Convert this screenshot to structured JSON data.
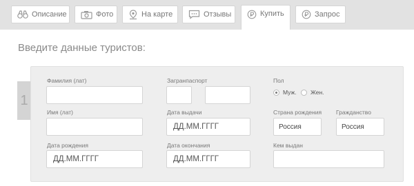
{
  "tabs": [
    {
      "label": "Описание",
      "icon": "binoculars-icon"
    },
    {
      "label": "Фото",
      "icon": "camera-icon"
    },
    {
      "label": "На карте",
      "icon": "map-pin-icon"
    },
    {
      "label": "Отзывы",
      "icon": "chat-icon"
    },
    {
      "label": "Купить",
      "icon": "ruble-coin-icon"
    },
    {
      "label": "Запрос",
      "icon": "ruble-coin-icon"
    }
  ],
  "active_tab": "Купить",
  "heading": "Введите данные туристов:",
  "tourist_number": "1",
  "fields": {
    "surname_label": "Фамилия (лат)",
    "name_label": "Имя (лат)",
    "birth_label": "Дата рождения",
    "birth_placeholder": "ДД.ММ.ГГГГ",
    "passport_label": "Загранпаспорт",
    "issue_label": "Дата выдачи",
    "issue_placeholder": "ДД.ММ.ГГГГ",
    "expiry_label": "Дата окончания",
    "expiry_placeholder": "ДД.ММ.ГГГГ",
    "gender_label": "Пол",
    "gender_male": "Муж.",
    "gender_female": "Жен.",
    "birth_country_label": "Страна рождения",
    "birth_country_value": "Россия",
    "citizenship_label": "Гражданство",
    "citizenship_value": "Россия",
    "issued_by_label": "Кем выдан"
  }
}
